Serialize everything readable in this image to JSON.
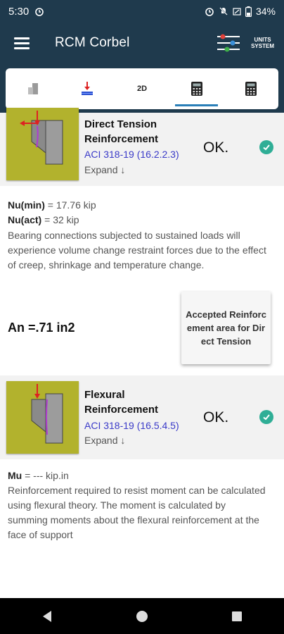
{
  "status_bar": {
    "time": "5:30",
    "battery": "34%"
  },
  "app_bar": {
    "title": "RCM Corbel",
    "units_line1": "UNITS",
    "units_line2": "SYSTEM"
  },
  "tabs": [
    {
      "icon": "building-icon"
    },
    {
      "icon": "load-icon"
    },
    {
      "label": "2D"
    },
    {
      "icon": "calculator-icon",
      "active": true
    },
    {
      "icon": "calculator-icon"
    }
  ],
  "cards": [
    {
      "title_line1": "Direct Tension",
      "title_line2": "Reinforcement",
      "reference": "ACI 318-19 (16.2.2.3)",
      "expand": "Expand ↓",
      "status": "OK."
    },
    {
      "title_line1": "Flexural",
      "title_line2": "Reinforcement",
      "reference": "ACI 318-19 (16.5.4.5)",
      "expand": "Expand ↓",
      "status": "OK."
    }
  ],
  "tension": {
    "nu_min_label": "Nu(min)",
    "nu_min_value": " = 17.76 kip",
    "nu_act_label": "Nu(act)",
    "nu_act_value": " = 32 kip",
    "description": "Bearing connections subjected to sustained loads will experience volume change restraint forces due to the effect of creep, shrinkage and temperature change.",
    "an": "An =.71 in2",
    "tooltip": "Accepted Reinforcement area for Direct Tension"
  },
  "flexural": {
    "mu_label": "Mu",
    "mu_value": " = --- kip.in",
    "description": "Reinforcement required to resist moment can be calculated using flexural theory. The moment is calculated by summing moments about the flexural reinforcement at the face of support"
  },
  "colors": {
    "header": "#1f3a4d",
    "thumb": "#b2b22d",
    "check": "#2fae96",
    "link": "#3a3ac8",
    "tab_indicator": "#2a7fb8"
  }
}
